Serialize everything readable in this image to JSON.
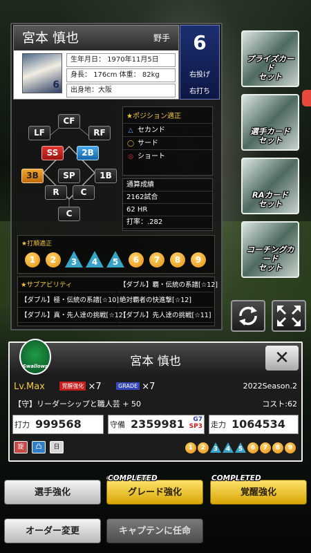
{
  "player": {
    "name": "宮本 慎也",
    "position_label": "野手",
    "uniform_number": "6",
    "throws": "右投げ",
    "bats": "右打ち",
    "birthdate": "生年月日： 1970年11月5日",
    "body": "身長： 176cm 体重： 82kg",
    "birthplace": "出身地：大阪"
  },
  "field_positions": [
    {
      "key": "CF",
      "label": "CF",
      "level": "normal"
    },
    {
      "key": "LF",
      "label": "LF",
      "level": "normal"
    },
    {
      "key": "RF",
      "label": "RF",
      "level": "normal"
    },
    {
      "key": "SS",
      "label": "SS",
      "level": "red"
    },
    {
      "key": "2B",
      "label": "2B",
      "level": "blue"
    },
    {
      "key": "3B",
      "label": "3B",
      "level": "orange"
    },
    {
      "key": "SP",
      "label": "SP",
      "level": "normal"
    },
    {
      "key": "1B",
      "label": "1B",
      "level": "normal"
    },
    {
      "key": "R",
      "label": "R",
      "level": "normal"
    },
    {
      "key": "C1",
      "label": "C",
      "level": "normal"
    },
    {
      "key": "C2",
      "label": "C",
      "level": "normal"
    }
  ],
  "aptitude": {
    "title": "★ポジション適正",
    "items": [
      {
        "mark": "△",
        "label": "セカンド",
        "mark_color": "#6fb0ff"
      },
      {
        "mark": "◯",
        "label": "サード",
        "mark_color": "#f4c83f"
      },
      {
        "mark": "◎",
        "label": "ショート",
        "mark_color": "#e0352d"
      }
    ]
  },
  "record": {
    "title": "通算成績",
    "games": "2162試合",
    "hr": "62 HR",
    "avg": "打率：.282"
  },
  "batting_order": {
    "title": "★打順適正",
    "items": [
      {
        "n": "1",
        "shape": "circle"
      },
      {
        "n": "2",
        "shape": "circle"
      },
      {
        "n": "3",
        "shape": "tri"
      },
      {
        "n": "4",
        "shape": "tri"
      },
      {
        "n": "5",
        "shape": "tri"
      },
      {
        "n": "6",
        "shape": "circle"
      },
      {
        "n": "7",
        "shape": "circle"
      },
      {
        "n": "8",
        "shape": "circle"
      },
      {
        "n": "9",
        "shape": "circle"
      }
    ]
  },
  "sub_ability": {
    "title": "★サブアビリティ",
    "cells": [
      "【ダブル】覇・伝統の系譜[☆12]",
      "【ダブル】極・伝統の系譜[☆10]",
      "絶対覇者の快進撃[☆12]",
      "【ダブル】真・先人達の挑戦[☆12]",
      "【ダブル】先人達の挑戦[☆11]"
    ]
  },
  "side_buttons": [
    {
      "label": "プライズカード\nセット"
    },
    {
      "label": "選手カード\nセット"
    },
    {
      "label": "RAカード\nセット"
    },
    {
      "label": "コーチングカード\nセット"
    }
  ],
  "status": {
    "name": "宮本 慎也",
    "team_logo_text": "Swallows",
    "level": "Lv.Max",
    "kakusei_tag": "覚醒強化",
    "kakusei_mult": "×7",
    "grade_tag": "GRADE",
    "grade_mult": "×7",
    "season": "2022Season.2",
    "skill": "【守】リーダーシップと職人芸 + 50",
    "cost": "コスト:62",
    "power_label": "打力",
    "power_value": "999568",
    "defense_label": "守備",
    "defense_value": "2359981",
    "grade_badge": "G7",
    "sp_badge": "SP3",
    "speed_label": "走力",
    "speed_value": "1064534",
    "mini_icons": [
      "旋",
      "凸",
      "日"
    ],
    "mini_order": [
      {
        "n": "1",
        "shape": "c"
      },
      {
        "n": "2",
        "shape": "c"
      },
      {
        "n": "3",
        "shape": "t"
      },
      {
        "n": "4",
        "shape": "t"
      },
      {
        "n": "5",
        "shape": "t"
      },
      {
        "n": "6",
        "shape": "c"
      },
      {
        "n": "7",
        "shape": "c"
      },
      {
        "n": "8",
        "shape": "c"
      },
      {
        "n": "9",
        "shape": "c"
      }
    ]
  },
  "actions": {
    "player_enhance": "選手強化",
    "grade_enhance": "グレード強化",
    "awaken_enhance": "覚醒強化",
    "completed": "COMPLETED",
    "order_change": "オーダー変更",
    "captain": "キャプテンに任命"
  }
}
